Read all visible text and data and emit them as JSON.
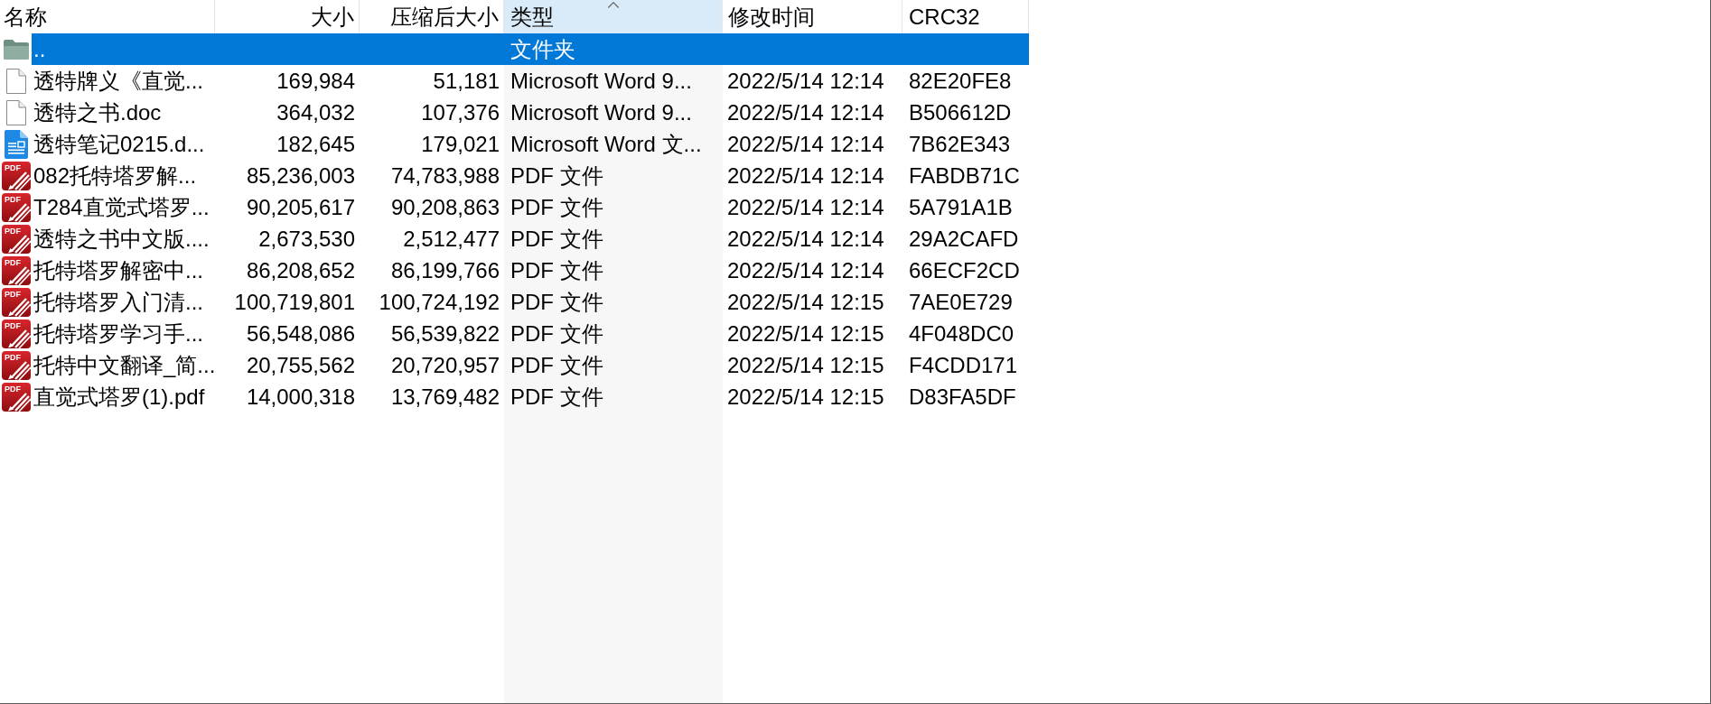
{
  "columns": [
    {
      "label": "名称",
      "sorted": false
    },
    {
      "label": "大小",
      "sorted": false
    },
    {
      "label": "压缩后大小",
      "sorted": false
    },
    {
      "label": "类型",
      "sorted": true
    },
    {
      "label": "修改时间",
      "sorted": false
    },
    {
      "label": "CRC32",
      "sorted": false
    }
  ],
  "rows": [
    {
      "kind": "folder",
      "name": "..",
      "type": "文件夹",
      "selected": true
    },
    {
      "kind": "document",
      "name": "透特牌义《直觉...",
      "size": "169,984",
      "packed_size": "51,181",
      "type": "Microsoft Word 9...",
      "modified": "2022/5/14 12:14",
      "crc32": "82E20FE8",
      "selected": false
    },
    {
      "kind": "document",
      "name": "透特之书.doc",
      "size": "364,032",
      "packed_size": "107,376",
      "type": "Microsoft Word 9...",
      "modified": "2022/5/14 12:14",
      "crc32": "B506612D",
      "selected": false
    },
    {
      "kind": "word",
      "name": "透特笔记0215.d...",
      "size": "182,645",
      "packed_size": "179,021",
      "type": "Microsoft Word 文...",
      "modified": "2022/5/14 12:14",
      "crc32": "7B62E343",
      "selected": false
    },
    {
      "kind": "pdf",
      "icon_label": "PDF",
      "name": "082托特塔罗解...",
      "size": "85,236,003",
      "packed_size": "74,783,988",
      "type": "PDF 文件",
      "modified": "2022/5/14 12:14",
      "crc32": "FABDB71C",
      "selected": false
    },
    {
      "kind": "pdf",
      "icon_label": "PDF",
      "name": "T284直觉式塔罗...",
      "size": "90,205,617",
      "packed_size": "90,208,863",
      "type": "PDF 文件",
      "modified": "2022/5/14 12:14",
      "crc32": "5A791A1B",
      "selected": false
    },
    {
      "kind": "pdf",
      "icon_label": "PDF",
      "name": "透特之书中文版....",
      "size": "2,673,530",
      "packed_size": "2,512,477",
      "type": "PDF 文件",
      "modified": "2022/5/14 12:14",
      "crc32": "29A2CAFD",
      "selected": false
    },
    {
      "kind": "pdf",
      "icon_label": "PDF",
      "name": "托特塔罗解密中...",
      "size": "86,208,652",
      "packed_size": "86,199,766",
      "type": "PDF 文件",
      "modified": "2022/5/14 12:14",
      "crc32": "66ECF2CD",
      "selected": false
    },
    {
      "kind": "pdf",
      "icon_label": "PDF",
      "name": "托特塔罗入门清...",
      "size": "100,719,801",
      "packed_size": "100,724,192",
      "type": "PDF 文件",
      "modified": "2022/5/14 12:15",
      "crc32": "7AE0E729",
      "selected": false
    },
    {
      "kind": "pdf",
      "icon_label": "PDF",
      "name": "托特塔罗学习手...",
      "size": "56,548,086",
      "packed_size": "56,539,822",
      "type": "PDF 文件",
      "modified": "2022/5/14 12:15",
      "crc32": "4F048DC0",
      "selected": false
    },
    {
      "kind": "pdf",
      "icon_label": "PDF",
      "name": "托特中文翻译_简...",
      "size": "20,755,562",
      "packed_size": "20,720,957",
      "type": "PDF 文件",
      "modified": "2022/5/14 12:15",
      "crc32": "F4CDD171",
      "selected": false
    },
    {
      "kind": "pdf",
      "icon_label": "PDF",
      "name": "直觉式塔罗(1).pdf",
      "size": "14,000,318",
      "packed_size": "13,769,482",
      "type": "PDF 文件",
      "modified": "2022/5/14 12:15",
      "crc32": "D83FA5DF",
      "selected": false
    }
  ]
}
